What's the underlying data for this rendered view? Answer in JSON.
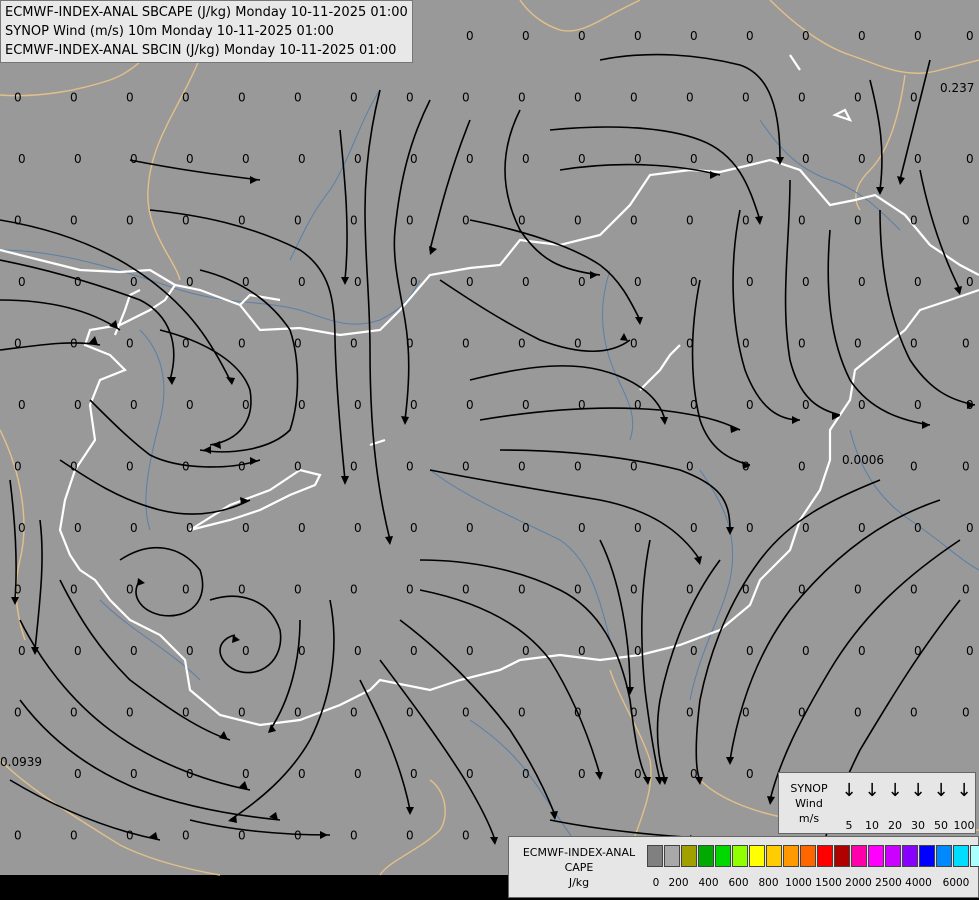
{
  "titles": [
    "ECMWF-INDEX-ANAL SBCAPE (J/kg) Monday 10-11-2025 01:00",
    "SYNOP Wind (m/s) 10m Monday 10-11-2025 01:00",
    "ECMWF-INDEX-ANAL SBCIN (J/kg) Monday 10-11-2025 01:00"
  ],
  "map_colors": {
    "background": "#999999",
    "border": "#ffffff",
    "neighbor_border": "#e3c08a",
    "river": "#5a7fa8",
    "streamline": "#000000",
    "bottom_strip": "#000000"
  },
  "value_labels": [
    "0",
    "0.237",
    "0.0006",
    "0.0939"
  ],
  "synop_legend": {
    "title_lines": [
      "SYNOP",
      "Wind",
      "m/s"
    ],
    "arrow_icon": "wind-arrow-down-icon",
    "values": [
      "5",
      "10",
      "20",
      "30",
      "50",
      "100"
    ]
  },
  "cape_legend": {
    "title_lines": [
      "ECMWF-INDEX-ANAL",
      "CAPE",
      "J/kg"
    ],
    "colors": [
      "#808080",
      "#a8a8a8",
      "#a0a000",
      "#00aa00",
      "#00d800",
      "#90ff00",
      "#ffff00",
      "#ffcc00",
      "#ff9900",
      "#ff6600",
      "#ff0000",
      "#b00000",
      "#ff00aa",
      "#ff00ff",
      "#cc00ff",
      "#8800ff",
      "#0000ff",
      "#0088ff",
      "#00ddff",
      "#aaffff",
      "#ffffff"
    ],
    "ticks": [
      "0",
      "200",
      "400",
      "600",
      "800",
      "1000",
      "1500",
      "2000",
      "2500",
      "4000",
      "6000"
    ]
  }
}
